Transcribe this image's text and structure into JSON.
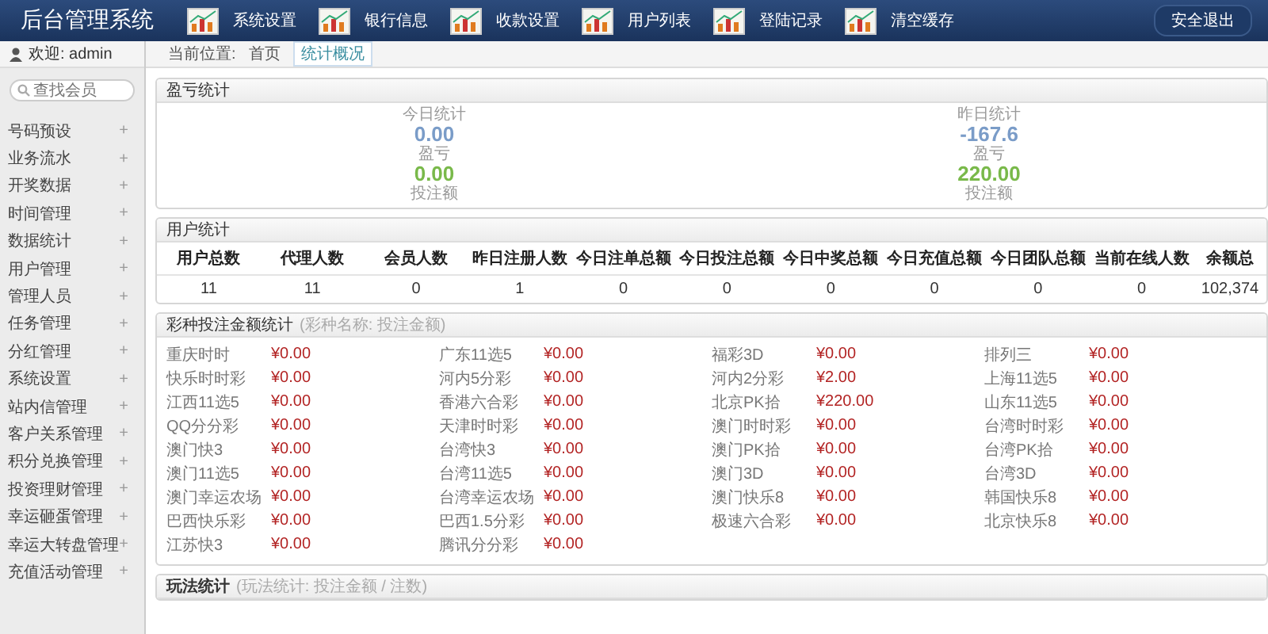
{
  "header": {
    "title": "后台管理系统",
    "nav": [
      "系统设置",
      "银行信息",
      "收款设置",
      "用户列表",
      "登陆记录",
      "清空缓存"
    ],
    "logout": "安全退出"
  },
  "sidebar": {
    "welcome": "欢迎: admin",
    "search": {
      "placeholder": "查找会员"
    },
    "items": [
      {
        "label": "号码预设",
        "expander": "+"
      },
      {
        "label": "业务流水",
        "expander": "+"
      },
      {
        "label": "开奖数据",
        "expander": "+"
      },
      {
        "label": "时间管理",
        "expander": "+"
      },
      {
        "label": "数据统计",
        "expander": "+"
      },
      {
        "label": "用户管理",
        "expander": "+"
      },
      {
        "label": "管理人员",
        "expander": "+"
      },
      {
        "label": "任务管理",
        "expander": "+"
      },
      {
        "label": "分红管理",
        "expander": "+"
      },
      {
        "label": "系统设置",
        "expander": "+"
      },
      {
        "label": "站内信管理",
        "expander": "+"
      },
      {
        "label": "客户关系管理",
        "expander": "+"
      },
      {
        "label": "积分兑换管理",
        "expander": "+"
      },
      {
        "label": "投资理财管理",
        "expander": "+"
      },
      {
        "label": "幸运砸蛋管理",
        "expander": "+"
      },
      {
        "label": "幸运大转盘管理",
        "expander": "+"
      },
      {
        "label": "充值活动管理",
        "expander": "+"
      }
    ]
  },
  "breadcrumb": {
    "label": "当前位置:",
    "items": [
      {
        "label": "首页",
        "selected": false
      },
      {
        "label": "统计概况",
        "selected": true
      }
    ]
  },
  "profit": {
    "title": "盈亏统计",
    "blocks": [
      {
        "heading": "今日统计",
        "profit": "0.00",
        "profit_label": "盈亏",
        "bet": "0.00",
        "bet_label": "投注额"
      },
      {
        "heading": "昨日统计",
        "profit": "-167.6",
        "profit_label": "盈亏",
        "bet": "220.00",
        "bet_label": "投注额"
      }
    ]
  },
  "users": {
    "title": "用户统计",
    "columns": [
      "用户总数",
      "代理人数",
      "会员人数",
      "昨日注册人数",
      "今日注单总额",
      "今日投注总额",
      "今日中奖总额",
      "今日充值总额",
      "今日团队总额",
      "当前在线人数",
      "余额总"
    ],
    "values": [
      "11",
      "11",
      "0",
      "1",
      "0",
      "0",
      "0",
      "0",
      "0",
      "0",
      "102,374"
    ]
  },
  "lottery": {
    "title": "彩种投注金额统计",
    "subtitle": "(彩种名称: 投注金额)",
    "columns": [
      [
        {
          "name": "重庆时时",
          "amount": "¥0.00"
        },
        {
          "name": "快乐时时彩",
          "amount": "¥0.00"
        },
        {
          "name": "江西11选5",
          "amount": "¥0.00"
        },
        {
          "name": "QQ分分彩",
          "amount": "¥0.00"
        },
        {
          "name": "澳门快3",
          "amount": "¥0.00"
        },
        {
          "name": "澳门11选5",
          "amount": "¥0.00"
        },
        {
          "name": "澳门幸运农场",
          "amount": "¥0.00"
        },
        {
          "name": "巴西快乐彩",
          "amount": "¥0.00"
        },
        {
          "name": "江苏快3",
          "amount": "¥0.00"
        }
      ],
      [
        {
          "name": "广东11选5",
          "amount": "¥0.00"
        },
        {
          "name": "河内5分彩",
          "amount": "¥0.00"
        },
        {
          "name": "香港六合彩",
          "amount": "¥0.00"
        },
        {
          "name": "天津时时彩",
          "amount": "¥0.00"
        },
        {
          "name": "台湾快3",
          "amount": "¥0.00"
        },
        {
          "name": "台湾11选5",
          "amount": "¥0.00"
        },
        {
          "name": "台湾幸运农场",
          "amount": "¥0.00"
        },
        {
          "name": "巴西1.5分彩",
          "amount": "¥0.00"
        },
        {
          "name": "腾讯分分彩",
          "amount": "¥0.00"
        }
      ],
      [
        {
          "name": "福彩3D",
          "amount": "¥0.00"
        },
        {
          "name": "河内2分彩",
          "amount": "¥2.00"
        },
        {
          "name": "北京PK拾",
          "amount": "¥220.00"
        },
        {
          "name": "澳门时时彩",
          "amount": "¥0.00"
        },
        {
          "name": "澳门PK拾",
          "amount": "¥0.00"
        },
        {
          "name": "澳门3D",
          "amount": "¥0.00"
        },
        {
          "name": "澳门快乐8",
          "amount": "¥0.00"
        },
        {
          "name": "极速六合彩",
          "amount": "¥0.00"
        }
      ],
      [
        {
          "name": "排列三",
          "amount": "¥0.00"
        },
        {
          "name": "上海11选5",
          "amount": "¥0.00"
        },
        {
          "name": "山东11选5",
          "amount": "¥0.00"
        },
        {
          "name": "台湾时时彩",
          "amount": "¥0.00"
        },
        {
          "name": "台湾PK拾",
          "amount": "¥0.00"
        },
        {
          "name": "台湾3D",
          "amount": "¥0.00"
        },
        {
          "name": "韩国快乐8",
          "amount": "¥0.00"
        },
        {
          "name": "北京快乐8",
          "amount": "¥0.00"
        }
      ]
    ]
  },
  "plays": {
    "title": "玩法统计",
    "subtitle": "(玩法统计: 投注金额 / 注数)"
  }
}
